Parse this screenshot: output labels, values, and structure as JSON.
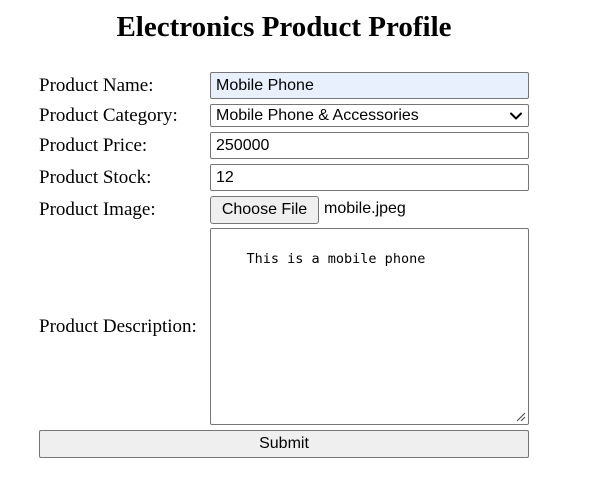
{
  "page_title": "Electronics Product Profile",
  "form": {
    "name_label": "Product Name:",
    "name_value": "Mobile Phone",
    "category_label": "Product Category:",
    "category_value": "Mobile Phone & Accessories",
    "price_label": "Product Price:",
    "price_value": "250000",
    "stock_label": "Product Stock:",
    "stock_value": "12",
    "image_label": "Product Image:",
    "image_button": "Choose File",
    "image_filename": "mobile.jpeg",
    "description_label": "Product Description:",
    "description_value": "This is a mobile phone",
    "submit_label": "Submit"
  },
  "icons": {
    "select": "chevron-down-icon",
    "textarea": "resize-handle-icon"
  },
  "colors": {
    "autofill_bg": "#e8f0fe",
    "button_bg": "#efefef",
    "border": "#767676"
  }
}
